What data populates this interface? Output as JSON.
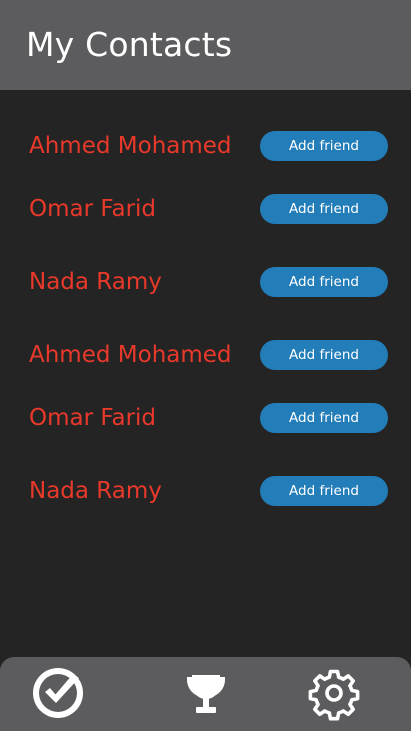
{
  "header": {
    "title": "My Contacts"
  },
  "contacts": [
    {
      "name": "Ahmed Mohamed",
      "action_label": "Add friend"
    },
    {
      "name": "Omar Farid",
      "action_label": "Add friend"
    },
    {
      "name": "Nada Ramy",
      "action_label": "Add friend"
    },
    {
      "name": "Ahmed Mohamed",
      "action_label": "Add friend"
    },
    {
      "name": "Omar Farid",
      "action_label": "Add friend"
    },
    {
      "name": "Nada Ramy",
      "action_label": "Add friend"
    }
  ],
  "bottom_nav": {
    "items": [
      {
        "icon": "check-circle-icon"
      },
      {
        "icon": "trophy-icon"
      },
      {
        "icon": "gear-icon"
      }
    ]
  },
  "colors": {
    "background": "#242424",
    "bars": "#5c5c5f",
    "name_text": "#e8392b",
    "button": "#237db8",
    "button_text": "#ffffff"
  }
}
